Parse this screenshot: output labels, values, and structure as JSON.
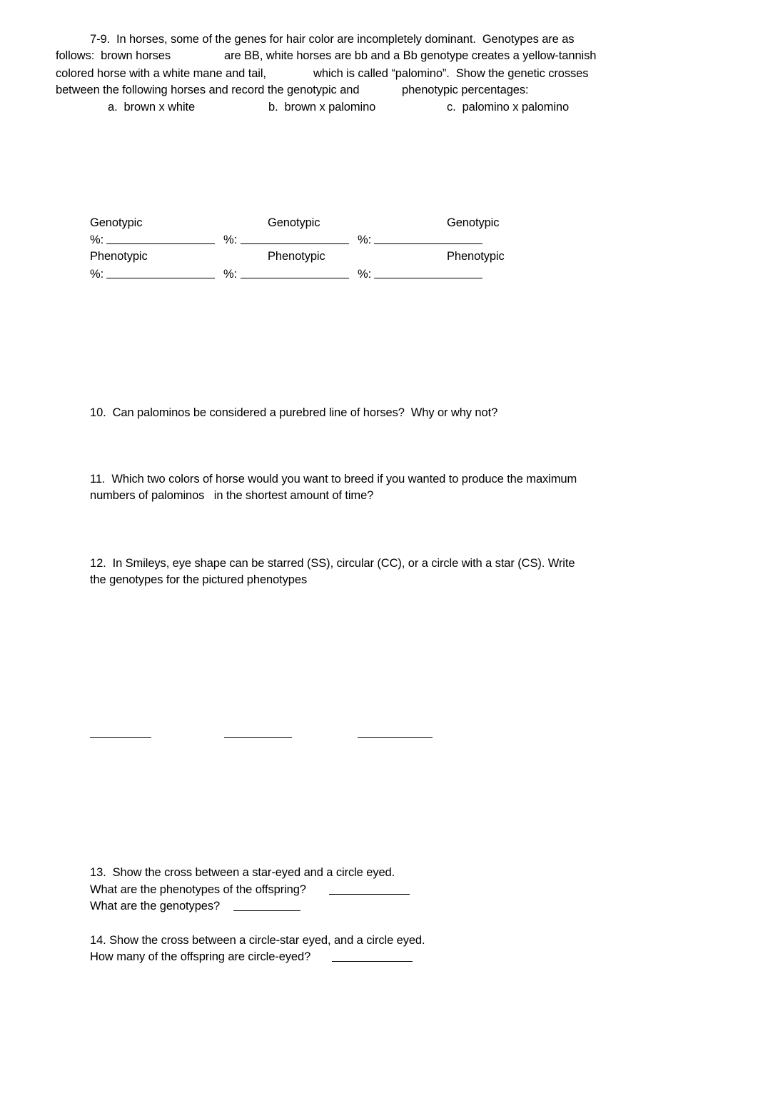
{
  "intro": {
    "lines": [
      "7-9.  In horses, some of the genes for hair color are incompletely dominant.  Genotypes are as",
      "follows:  brown horses",
      "are BB, white horses are bb and a Bb genotype creates a yellow-tannish",
      "colored horse with a white mane and tail,",
      "which is called “palomino”.  Show the genetic crosses",
      "between the following horses and record the genotypic and",
      "phenotypic percentages:"
    ],
    "crosses": [
      "a.  brown x white",
      "b.  brown x palomino",
      "c.  palomino x palomino"
    ]
  },
  "results": {
    "genotypic_label": "Genotypic",
    "phenotypic_label": "Phenotypic",
    "percent_label": "%:"
  },
  "questions": {
    "q10": "10.  Can palominos be considered a purebred line of horses?  Why or why not?",
    "q11_line1": "11.  Which two colors of horse would you want to breed if you wanted to produce the maximum",
    "q11_line2": "numbers of palominos   in the shortest amount of time?",
    "q12_line1": "12.  In Smileys, eye shape can be starred (SS), circular (CC), or a circle with a star (CS). Write",
    "q12_line2": "the genotypes for the pictured phenotypes",
    "q13_line1": "13.  Show the cross between a star-eyed and a circle eyed.",
    "q13_line2": "What are the phenotypes of the offspring?",
    "q13_line3": "What are the genotypes?",
    "q14_line1": "14. Show the cross between a circle-star eyed, and a circle eyed.",
    "q14_line2": "How many of the offspring are circle-eyed?"
  }
}
